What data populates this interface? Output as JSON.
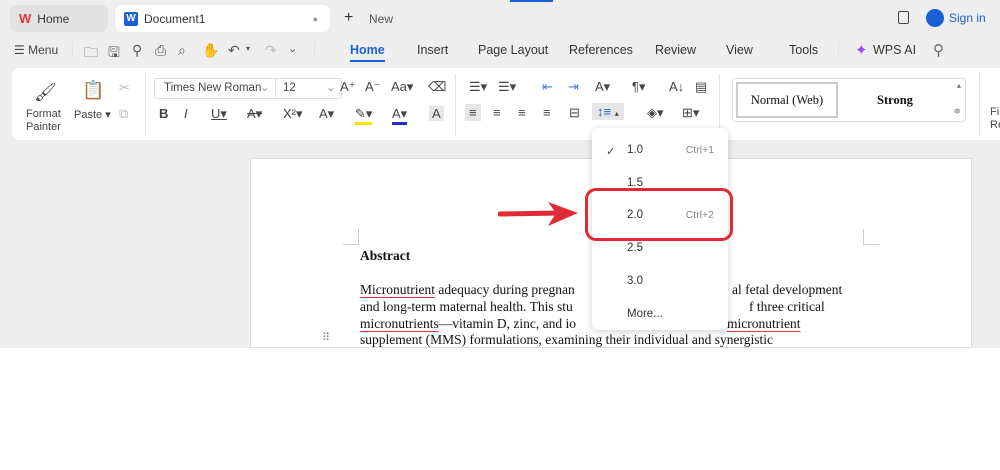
{
  "tabs": [
    {
      "label": "Home",
      "icon": "wps-logo-icon"
    },
    {
      "label": "Document1",
      "icon": "word-doc-icon"
    }
  ],
  "new_tab": "New",
  "sign_in": "Sign in",
  "menu_label": "Menu",
  "ribbon_tabs": [
    "Home",
    "Insert",
    "Page Layout",
    "References",
    "Review",
    "View",
    "Tools"
  ],
  "active_tab": "Home",
  "wps_ai": "WPS AI",
  "ribbon": {
    "format_painter_1": "Format",
    "format_painter_2": "Painter",
    "paste": "Paste",
    "font": "Times New Roman",
    "size": "12",
    "styles": [
      "Normal (Web)",
      "Strong"
    ],
    "find_1": "Fi",
    "find_2": "Re"
  },
  "line_spacing_menu": {
    "items": [
      {
        "value": "1.0",
        "shortcut": "Ctrl+1",
        "checked": true
      },
      {
        "value": "1.5",
        "shortcut": ""
      },
      {
        "value": "2.0",
        "shortcut": "Ctrl+2",
        "highlighted": true
      },
      {
        "value": "2.5",
        "shortcut": ""
      },
      {
        "value": "3.0",
        "shortcut": ""
      },
      {
        "value": "More...",
        "shortcut": ""
      }
    ]
  },
  "document": {
    "heading": "Abstract",
    "l1a": "Micronutrient",
    "l1b": " adequacy during pregnan",
    "l1c": "al fetal development",
    "l2a": "and long-term maternal health. This stu",
    "l2b": "f three critical",
    "l3a": "micronutrients",
    "l3b": "—vitamin D, zinc, and io",
    "l3c": "micronutrient",
    "l4": "supplement (MMS) formulations, examining their individual and synergistic"
  },
  "colors": {
    "accent": "#1a5fd6",
    "annotation": "#e02a35",
    "ai": "#a24bf0"
  }
}
